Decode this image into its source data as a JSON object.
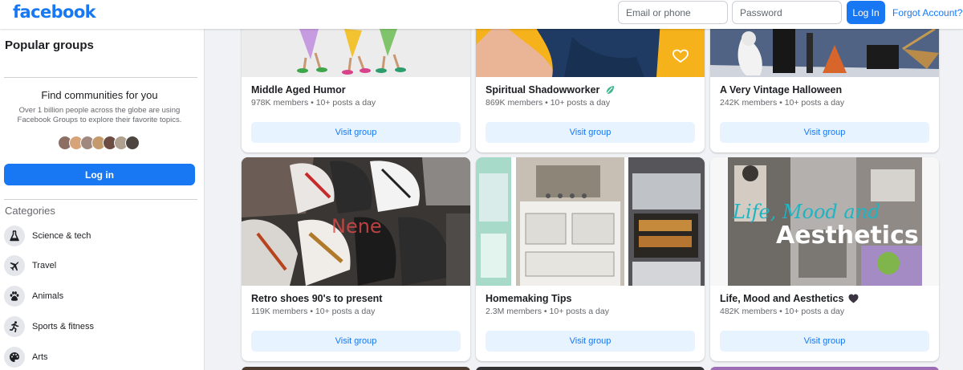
{
  "header": {
    "logo": "facebook",
    "email_placeholder": "Email or phone",
    "password_placeholder": "Password",
    "login_label": "Log In",
    "forgot_label": "Forgot Account?",
    "brand_color": "#1877f2"
  },
  "sidebar": {
    "title": "Popular groups",
    "find_title": "Find communities for you",
    "find_desc": "Over 1 billion people across the globe are using Facebook Groups to explore their favorite topics.",
    "login_label": "Log in",
    "categories_title": "Categories",
    "categories": [
      {
        "label": "Science & tech",
        "icon": "flask-icon"
      },
      {
        "label": "Travel",
        "icon": "airplane-icon"
      },
      {
        "label": "Animals",
        "icon": "paw-icon"
      },
      {
        "label": "Sports & fitness",
        "icon": "runner-icon"
      },
      {
        "label": "Arts",
        "icon": "palette-icon"
      }
    ]
  },
  "groups": [
    {
      "name": "Middle Aged Humor",
      "meta": "978K members • 10+ posts a day",
      "visit": "Visit group",
      "badge": ""
    },
    {
      "name": "Spiritual Shadowworker",
      "meta": "869K members • 10+ posts a day",
      "visit": "Visit group",
      "badge": "leaf-emoji-icon"
    },
    {
      "name": "A Very Vintage Halloween",
      "meta": "242K members • 10+ posts a day",
      "visit": "Visit group",
      "badge": ""
    },
    {
      "name": "Retro shoes 90's to present",
      "meta": "119K members • 10+ posts a day",
      "visit": "Visit group",
      "badge": ""
    },
    {
      "name": "Homemaking Tips",
      "meta": "2.3M members • 10+ posts a day",
      "visit": "Visit group",
      "badge": ""
    },
    {
      "name": "Life, Mood and Aesthetics",
      "meta": "482K members • 10+ posts a day",
      "visit": "Visit group",
      "badge": "black-heart-icon"
    }
  ],
  "image_text": {
    "shoes_watermark": "Nene",
    "aesthetics_line1": "Life, Mood and",
    "aesthetics_line2": "Aesthetics"
  }
}
